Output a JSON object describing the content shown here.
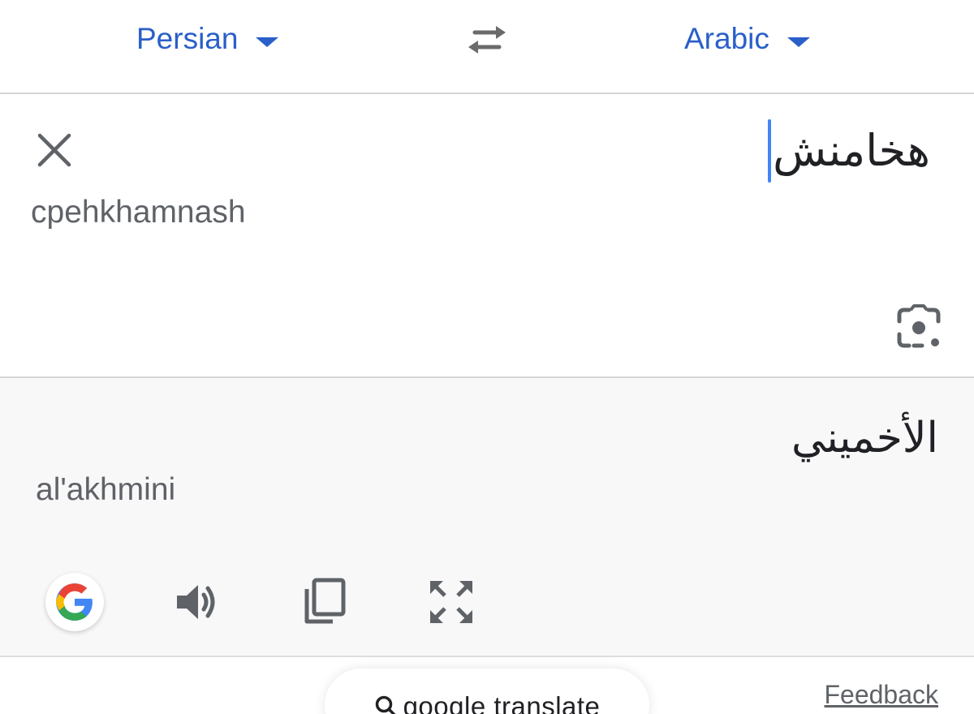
{
  "language_bar": {
    "source_language": "Persian",
    "target_language": "Arabic",
    "accent_color": "#2a5fc9",
    "swap_icon": "swap-arrows-icon",
    "dropdown_icon": "caret-down-icon"
  },
  "source": {
    "text": "هخامنش",
    "transliteration": "cpehkhamnash",
    "clear_icon": "close-icon",
    "camera_icon": "camera-lens-icon",
    "cursor_color": "#4285f4"
  },
  "result": {
    "text": "الأخميني",
    "transliteration": "al'akhmini",
    "actions": [
      {
        "name": "google-button",
        "icon": "google-g-icon"
      },
      {
        "name": "listen-button",
        "icon": "speaker-icon"
      },
      {
        "name": "copy-button",
        "icon": "copy-icon"
      },
      {
        "name": "fullscreen-button",
        "icon": "expand-icon"
      }
    ]
  },
  "footer": {
    "search_label": "google translate",
    "search_icon": "search-icon",
    "feedback_label": "Feedback"
  }
}
